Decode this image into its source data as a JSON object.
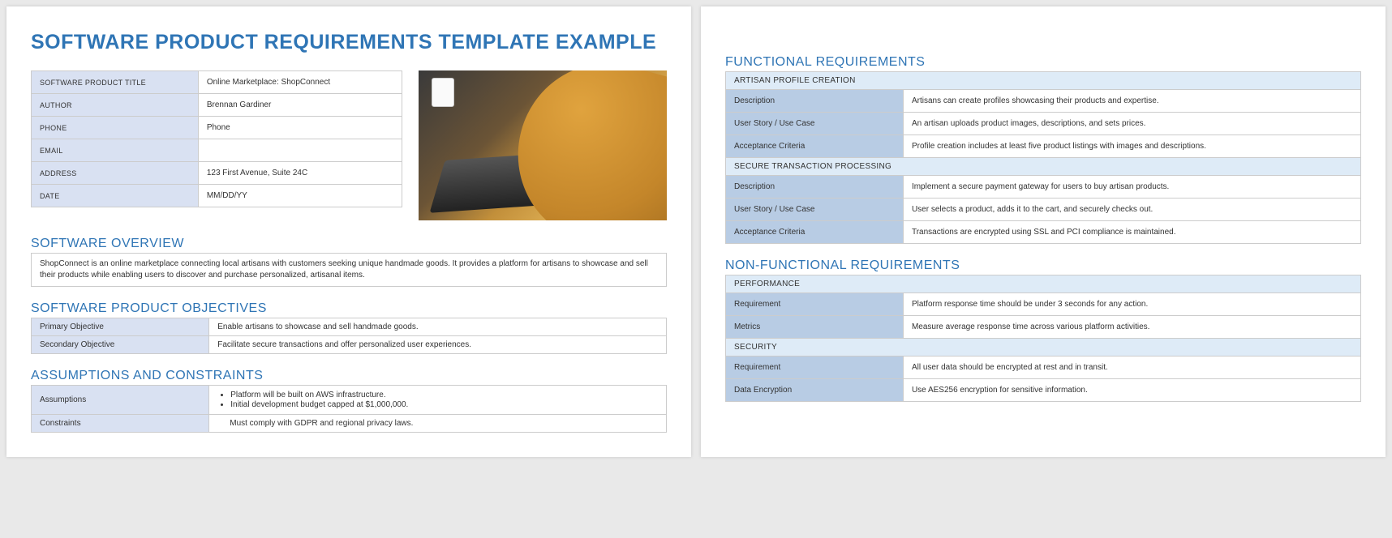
{
  "title": "SOFTWARE PRODUCT REQUIREMENTS TEMPLATE EXAMPLE",
  "info": {
    "product_title_key": "SOFTWARE PRODUCT TITLE",
    "product_title_val": "Online Marketplace: ShopConnect",
    "author_key": "AUTHOR",
    "author_val": "Brennan Gardiner",
    "phone_key": "PHONE",
    "phone_val": "Phone",
    "email_key": "EMAIL",
    "email_val": "",
    "address_key": "ADDRESS",
    "address_val": "123 First Avenue, Suite 24C",
    "date_key": "DATE",
    "date_val": "MM/DD/YY"
  },
  "overview": {
    "heading": "SOFTWARE OVERVIEW",
    "text": "ShopConnect is an online marketplace connecting local artisans with customers seeking unique handmade goods. It provides a platform for artisans to showcase and sell their products while enabling users to discover and purchase personalized, artisanal items."
  },
  "objectives": {
    "heading": "SOFTWARE PRODUCT OBJECTIVES",
    "primary_key": "Primary Objective",
    "primary_val": "Enable artisans to showcase and sell handmade goods.",
    "secondary_key": "Secondary Objective",
    "secondary_val": "Facilitate secure transactions and offer personalized user experiences."
  },
  "assumptions": {
    "heading": "ASSUMPTIONS AND CONSTRAINTS",
    "assumptions_key": "Assumptions",
    "assumptions_b1": "Platform will be built on AWS infrastructure.",
    "assumptions_b2": "Initial development budget capped at $1,000,000.",
    "constraints_key": "Constraints",
    "constraints_val": "Must comply with GDPR and regional privacy laws."
  },
  "functional": {
    "heading": "FUNCTIONAL REQUIREMENTS",
    "g1_title": "ARTISAN PROFILE CREATION",
    "g1_r1_k": "Description",
    "g1_r1_v": "Artisans can create profiles showcasing their products and expertise.",
    "g1_r2_k": "User Story / Use Case",
    "g1_r2_v": "An artisan uploads product images, descriptions, and sets prices.",
    "g1_r3_k": "Acceptance Criteria",
    "g1_r3_v": "Profile creation includes at least five product listings with images and descriptions.",
    "g2_title": "SECURE TRANSACTION PROCESSING",
    "g2_r1_k": "Description",
    "g2_r1_v": "Implement a secure payment gateway for users to buy artisan products.",
    "g2_r2_k": "User Story / Use Case",
    "g2_r2_v": "User selects a product, adds it to the cart, and securely checks out.",
    "g2_r3_k": "Acceptance Criteria",
    "g2_r3_v": "Transactions are encrypted using SSL and PCI compliance is maintained."
  },
  "nonfunctional": {
    "heading": "NON-FUNCTIONAL REQUIREMENTS",
    "g1_title": "PERFORMANCE",
    "g1_r1_k": "Requirement",
    "g1_r1_v": "Platform response time should be under 3 seconds for any action.",
    "g1_r2_k": "Metrics",
    "g1_r2_v": "Measure average response time across various platform activities.",
    "g2_title": "SECURITY",
    "g2_r1_k": "Requirement",
    "g2_r1_v": "All user data should be encrypted at rest and in transit.",
    "g2_r2_k": "Data Encryption",
    "g2_r2_v": "Use AES256 encryption for sensitive information."
  }
}
